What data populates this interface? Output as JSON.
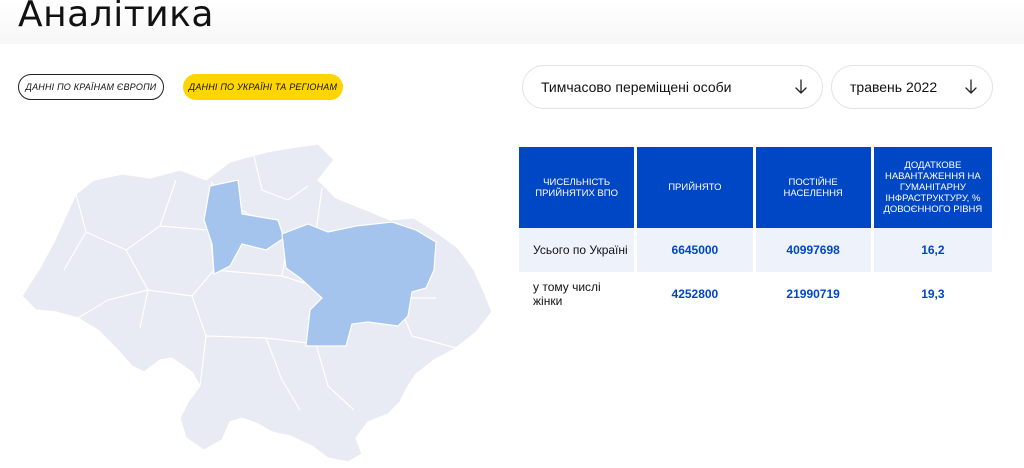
{
  "header": {
    "title": "Аналітика"
  },
  "tabs": [
    {
      "label": "Данні по країнам Європи",
      "active": false
    },
    {
      "label": "Данні по Україні та регіонам",
      "active": true
    }
  ],
  "filters": {
    "category": {
      "value": "Тимчасово переміщені особи",
      "icon": "arrow-down-icon"
    },
    "month": {
      "value": "травень 2022",
      "icon": "arrow-down-icon"
    }
  },
  "table": {
    "headers": [
      "Чисельність прийнятих ВПО",
      "Прийнято",
      "Постійне населення",
      "Додаткове навантаження на гуманітарну інфраструктуру, % довоєнного рівня"
    ],
    "rows": [
      {
        "label": "Усього по Україні",
        "accepted": "6645000",
        "population": "40997698",
        "load": "16,2"
      },
      {
        "label": "у тому числі жінки",
        "accepted": "4252800",
        "population": "21990719",
        "load": "19,3"
      }
    ]
  },
  "map": {
    "icon": "ukraine-map",
    "colors": {
      "region": "#e8eaf4",
      "highlight": "#a4c3ed",
      "border": "#ffffff"
    },
    "highlighted_regions": [
      "west-central",
      "central-east"
    ]
  },
  "colors": {
    "accent": "#0047c5",
    "active_tab": "#ffd500"
  }
}
